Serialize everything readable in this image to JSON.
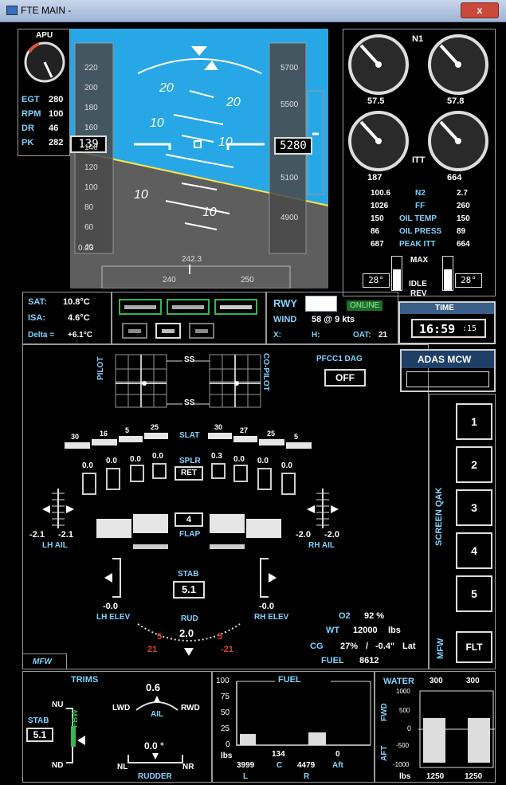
{
  "window": {
    "title": "FTE MAIN -",
    "close": "x"
  },
  "apu": {
    "title": "APU",
    "rows": [
      {
        "label": "EGT",
        "value": "280"
      },
      {
        "label": "RPM",
        "value": "100"
      },
      {
        "label": "DR",
        "value": "46"
      },
      {
        "label": "PK",
        "value": "282"
      }
    ]
  },
  "pfd": {
    "speed_ticks": [
      "220",
      "200",
      "180",
      "160",
      "140",
      "120",
      "100",
      "80",
      "60",
      "40"
    ],
    "speed_current": "139",
    "speed_bottom": "0.23",
    "alt_ticks": [
      "5700",
      "5500",
      "5280",
      "5100",
      "4900"
    ],
    "alt_current": "5280",
    "pitch_labels": [
      "20",
      "20",
      "10",
      "10",
      "10",
      "10"
    ],
    "heading_current": "242.3",
    "heading_ticks": [
      "240",
      "250"
    ]
  },
  "engine": {
    "n1_label": "N1",
    "n1_values": [
      "57.5",
      "57.8"
    ],
    "itt_label": "ITT",
    "itt_values": [
      "187",
      "664"
    ],
    "rows": [
      {
        "left": "100.6",
        "label": "N2",
        "right": "2.7"
      },
      {
        "left": "1026",
        "label": "FF",
        "right": "260"
      },
      {
        "left": "150",
        "label": "OIL TEMP",
        "right": "150"
      },
      {
        "left": "86",
        "label": "OIL PRESS",
        "right": "89"
      },
      {
        "left": "687",
        "label": "PEAK ITT",
        "right": "664"
      }
    ],
    "thrust_labels": {
      "max": "MAX",
      "idle": "IDLE",
      "rev": "REV"
    },
    "tla_left": "28°",
    "tla_right": "28°"
  },
  "air": {
    "sat_label": "SAT:",
    "sat": "10.8°C",
    "isa_label": "ISA:",
    "isa": "4.6°C",
    "delta_label": "Delta =",
    "delta": "+6.1°C"
  },
  "runway": {
    "rwy_label": "RWY",
    "online": "ONLINE",
    "wind_label": "WIND",
    "wind": "58 @ 9 kts",
    "x_label": "X:",
    "h_label": "H:",
    "oat_label": "OAT:",
    "oat": "21"
  },
  "time": {
    "label": "TIME",
    "value": "16:59",
    "seconds": ":15"
  },
  "controls": {
    "pilot": "PILOT",
    "copilot": "CO-PILOT",
    "ss_top": "SS",
    "ss_bottom": "SS",
    "ss_top2": "SS",
    "ss_bottom2": "SS",
    "pfcc_label": "PFCC1 DAG",
    "pfcc_value": "OFF",
    "adas": "ADAS MCW"
  },
  "surfaces": {
    "slat_label": "SLAT",
    "slat_values": [
      "30",
      "16",
      "5",
      "25",
      "30",
      "27",
      "25",
      "5"
    ],
    "splr_label": "SPLR",
    "splr_ret": "RET",
    "splr_values": [
      "0.0",
      "0.0",
      "0.0",
      "0.0",
      "0.3",
      "0.0",
      "0.0",
      "0.0"
    ],
    "flap_label": "FLAP",
    "flap_value": "4",
    "lh_ail_label": "LH AIL",
    "lh_ail_values": [
      "-2.1",
      "-2.1"
    ],
    "rh_ail_label": "RH AIL",
    "rh_ail_values": [
      "-2.0",
      "-2.0"
    ],
    "stab_label": "STAB",
    "stab_value": "5.1",
    "lh_elev_label": "LH ELEV",
    "lh_elev_value": "-0.0",
    "rh_elev_label": "RH ELEV",
    "rh_elev_value": "-0.0",
    "rud_label": "RUD",
    "rud_value": "2.0",
    "rud_left": "21",
    "rud_right": "-21",
    "rud_marks": [
      "5",
      "5"
    ]
  },
  "weights": {
    "o2_label": "O2",
    "o2": "92 %",
    "wt_label": "WT",
    "wt": "12000",
    "wt_unit": "lbs",
    "cg_label": "CG",
    "cg": "27%",
    "cg_sep": "/",
    "cg_lat": "-0.4\"",
    "cg_lat_unit": "Lat",
    "fuel_label": "FUEL",
    "fuel": "8612"
  },
  "qak": {
    "title": "SCREEN QAK",
    "buttons": [
      "1",
      "2",
      "3",
      "4",
      "5"
    ],
    "mfw_label": "MFW",
    "flt": "FLT"
  },
  "mfw_tab": "MFW",
  "trims": {
    "title": "TRIMS",
    "nu": "NU",
    "nd": "ND",
    "fbw": "FBW",
    "stab_label": "STAB",
    "stab_value": "5.1",
    "ail_value": "0.6",
    "ail_label": "AIL",
    "lwd": "LWD",
    "rwd": "RWD",
    "rudder_value": "0.0 °",
    "rudder_label": "RUDDER",
    "nl": "NL",
    "nr": "NR"
  },
  "fuel": {
    "title": "FUEL",
    "y_ticks": [
      "100",
      "75",
      "50",
      "25",
      "0"
    ],
    "unit": "lbs",
    "l": "3999",
    "l_label": "L",
    "c": "134",
    "c_label": "C",
    "r": "4479",
    "r_label": "R",
    "aft": "0",
    "aft_label": "Aft",
    "levels": {
      "l": 0.18,
      "c": 0.0,
      "r": 0.2,
      "aft": 0.0
    }
  },
  "water": {
    "title": "WATER",
    "top_values": [
      "300",
      "300"
    ],
    "fwd": "FWD",
    "aft": "AFT",
    "y_ticks": [
      "1000",
      "500",
      "0",
      "-500",
      "-1000"
    ],
    "unit": "lbs",
    "bottom_values": [
      "1250",
      "1250"
    ]
  }
}
